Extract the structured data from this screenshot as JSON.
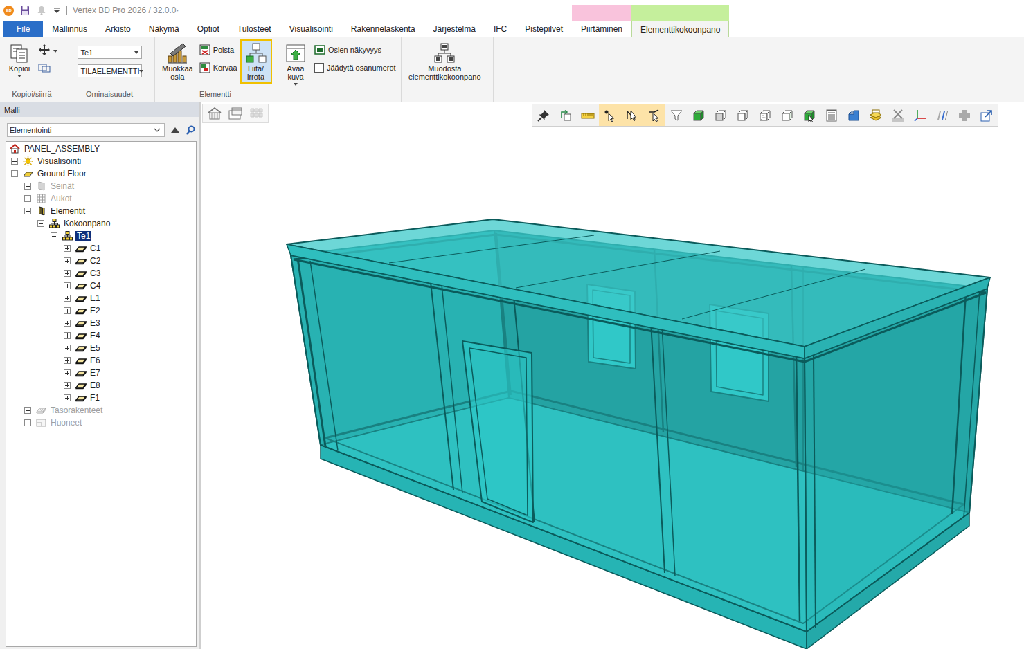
{
  "window": {
    "title": "Vertex BD Pro 2026 / 32.0.0·",
    "logo": "BD"
  },
  "quick_access": [
    {
      "kind": "save"
    },
    {
      "kind": "bell"
    },
    {
      "kind": "customize"
    }
  ],
  "tabs": [
    {
      "label": "File",
      "selected": false,
      "kind": "file"
    },
    {
      "label": "Mallinnus",
      "selected": false,
      "kind": "tab"
    },
    {
      "label": "Arkisto",
      "selected": false,
      "kind": "tab"
    },
    {
      "label": "Näkymä",
      "selected": false,
      "kind": "tab"
    },
    {
      "label": "Optiot",
      "selected": false,
      "kind": "tab"
    },
    {
      "label": "Tulosteet",
      "selected": false,
      "kind": "tab"
    },
    {
      "label": "Visualisointi",
      "selected": false,
      "kind": "tab"
    },
    {
      "label": "Rakennelaskenta",
      "selected": false,
      "kind": "tab"
    },
    {
      "label": "Järjestelmä",
      "selected": false,
      "kind": "tab"
    },
    {
      "label": "IFC",
      "selected": false,
      "kind": "tab"
    },
    {
      "label": "Pistepilvet",
      "selected": false,
      "kind": "tab"
    },
    {
      "label": "Piirtäminen",
      "selected": false,
      "kind": "tab",
      "color": "#f9c3dc"
    },
    {
      "label": "Elementtikokoonpano",
      "selected": true,
      "kind": "tab",
      "color": "#c5ef9c"
    }
  ],
  "ribbon": {
    "copy_group": {
      "label": "Kopioi/siirrä",
      "copy": {
        "label": "Kopioi",
        "dropdown": true
      },
      "move": {
        "dropdown": true
      }
    },
    "properties_group": {
      "label": "Ominaisuudet",
      "fields": [
        {
          "value": "Te1"
        },
        {
          "value": "TILAELEMENTTI"
        }
      ]
    },
    "element_group": {
      "label": "Elementti",
      "edit": {
        "lines": [
          "Muokkaa",
          "osia"
        ]
      },
      "small": [
        {
          "label": "Poista",
          "kind": "delete"
        },
        {
          "label": "Korvaa",
          "kind": "replace"
        }
      ],
      "attach": {
        "lines": [
          "Liitä/",
          "irrota"
        ],
        "selected": true
      }
    },
    "view_group": {
      "open_image": {
        "lines": [
          "Avaa",
          "kuva"
        ],
        "dropdown": true
      },
      "visibility": {
        "label": "Osien näkyvyys"
      },
      "freeze": {
        "label": "Jäädytä osanumerot",
        "checked": false
      }
    },
    "assembly_group": {
      "create": {
        "lines": [
          "Muodosta",
          "elementtikokoonpano"
        ]
      }
    }
  },
  "model_panel": {
    "title": "Malli",
    "view": {
      "value": "Elementointi"
    },
    "tree": [
      {
        "label": "PANEL_ASSEMBLY",
        "level": 0,
        "kind": "house",
        "has_children": false,
        "expanded": false,
        "greyed": false,
        "selected": false
      },
      {
        "label": "Visualisointi",
        "level": 1,
        "kind": "sun",
        "has_children": true,
        "expanded": false,
        "greyed": false,
        "selected": false
      },
      {
        "label": "Ground Floor",
        "level": 1,
        "kind": "floor",
        "has_children": true,
        "expanded": true,
        "greyed": false,
        "selected": false
      },
      {
        "label": "Seinät",
        "level": 2,
        "kind": "wall",
        "has_children": true,
        "expanded": false,
        "greyed": true,
        "selected": false
      },
      {
        "label": "Aukot",
        "level": 2,
        "kind": "opening",
        "has_children": true,
        "expanded": false,
        "greyed": true,
        "selected": false
      },
      {
        "label": "Elementit",
        "level": 2,
        "kind": "element",
        "has_children": true,
        "expanded": true,
        "greyed": false,
        "selected": false
      },
      {
        "label": "Kokoonpano",
        "level": 3,
        "kind": "assembly",
        "has_children": true,
        "expanded": true,
        "greyed": false,
        "selected": false
      },
      {
        "label": "Te1",
        "level": 4,
        "kind": "assembly",
        "has_children": true,
        "expanded": true,
        "greyed": false,
        "selected": true
      },
      {
        "label": "C1",
        "level": 5,
        "kind": "part",
        "has_children": true,
        "expanded": false,
        "greyed": false,
        "selected": false
      },
      {
        "label": "C2",
        "level": 5,
        "kind": "part",
        "has_children": true,
        "expanded": false,
        "greyed": false,
        "selected": false
      },
      {
        "label": "C3",
        "level": 5,
        "kind": "part",
        "has_children": true,
        "expanded": false,
        "greyed": false,
        "selected": false
      },
      {
        "label": "C4",
        "level": 5,
        "kind": "part",
        "has_children": true,
        "expanded": false,
        "greyed": false,
        "selected": false
      },
      {
        "label": "E1",
        "level": 5,
        "kind": "part",
        "has_children": true,
        "expanded": false,
        "greyed": false,
        "selected": false
      },
      {
        "label": "E2",
        "level": 5,
        "kind": "part",
        "has_children": true,
        "expanded": false,
        "greyed": false,
        "selected": false
      },
      {
        "label": "E3",
        "level": 5,
        "kind": "part",
        "has_children": true,
        "expanded": false,
        "greyed": false,
        "selected": false
      },
      {
        "label": "E4",
        "level": 5,
        "kind": "part",
        "has_children": true,
        "expanded": false,
        "greyed": false,
        "selected": false
      },
      {
        "label": "E5",
        "level": 5,
        "kind": "part",
        "has_children": true,
        "expanded": false,
        "greyed": false,
        "selected": false
      },
      {
        "label": "E6",
        "level": 5,
        "kind": "part",
        "has_children": true,
        "expanded": false,
        "greyed": false,
        "selected": false
      },
      {
        "label": "E7",
        "level": 5,
        "kind": "part",
        "has_children": true,
        "expanded": false,
        "greyed": false,
        "selected": false
      },
      {
        "label": "E8",
        "level": 5,
        "kind": "part",
        "has_children": true,
        "expanded": false,
        "greyed": false,
        "selected": false
      },
      {
        "label": "F1",
        "level": 5,
        "kind": "part",
        "has_children": true,
        "expanded": false,
        "greyed": false,
        "selected": false
      },
      {
        "label": "Tasorakenteet",
        "level": 2,
        "kind": "slab",
        "has_children": true,
        "expanded": false,
        "greyed": true,
        "selected": false
      },
      {
        "label": "Huoneet",
        "level": 2,
        "kind": "room",
        "has_children": true,
        "expanded": false,
        "greyed": true,
        "selected": false
      }
    ]
  },
  "viewport": {
    "view_buttons": [
      {
        "kind": "house",
        "disabled": false
      },
      {
        "kind": "window",
        "disabled": false
      },
      {
        "kind": "grid",
        "disabled": true
      }
    ],
    "toolbar": [
      {
        "kind": "pin",
        "selected": false
      },
      {
        "kind": "rotate",
        "selected": false
      },
      {
        "kind": "ruler",
        "selected": false
      },
      {
        "kind": "pick-point",
        "selected": true
      },
      {
        "kind": "pick",
        "selected": true
      },
      {
        "kind": "pick-edge",
        "selected": true
      },
      {
        "kind": "filter",
        "selected": false
      },
      {
        "kind": "cube-solid",
        "selected": false
      },
      {
        "kind": "cube-front",
        "selected": false
      },
      {
        "kind": "cube-side",
        "selected": false
      },
      {
        "kind": "cube-back",
        "selected": false
      },
      {
        "kind": "cube-iso",
        "selected": false
      },
      {
        "kind": "cube-pick",
        "selected": false
      },
      {
        "kind": "list",
        "selected": false
      },
      {
        "kind": "shape",
        "selected": false
      },
      {
        "kind": "layers",
        "selected": false
      },
      {
        "kind": "clear",
        "selected": false
      },
      {
        "kind": "axes",
        "selected": false
      },
      {
        "kind": "section",
        "selected": false
      },
      {
        "kind": "plus",
        "selected": false
      },
      {
        "kind": "export",
        "selected": false
      }
    ]
  }
}
